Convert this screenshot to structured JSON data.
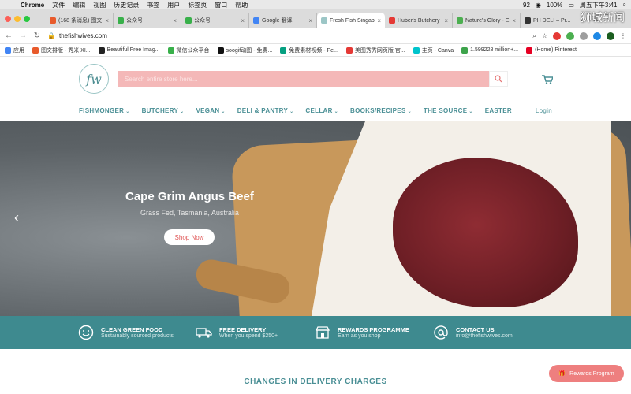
{
  "os_menubar": {
    "apple": "",
    "app": "Chrome",
    "menus": [
      "文件",
      "编辑",
      "视图",
      "历史记录",
      "书签",
      "用户",
      "标签页",
      "窗口",
      "帮助"
    ],
    "battery": "100%",
    "clock": "周五下午3:41",
    "badge": "92"
  },
  "tabs": [
    {
      "title": "(168 条消息) 图文",
      "fav_color": "#e85a2b"
    },
    {
      "title": "公众号",
      "fav_color": "#38b04a"
    },
    {
      "title": "公众号",
      "fav_color": "#38b04a"
    },
    {
      "title": "Google 翻译",
      "fav_color": "#4285f4"
    },
    {
      "title": "Fresh Fish Singap",
      "fav_color": "#9cc6c6",
      "active": true
    },
    {
      "title": "Huber's Butchery",
      "fav_color": "#e53935"
    },
    {
      "title": "Nature's Glory - E",
      "fav_color": "#4caf50"
    },
    {
      "title": "PH DELI – Pr...",
      "fav_color": "#333333"
    }
  ],
  "address": {
    "url": "thefishwives.com"
  },
  "bookmarks": [
    {
      "label": "应用",
      "color": "#4285f4"
    },
    {
      "label": "图文排版 - 秀米 XI...",
      "color": "#e85a2b"
    },
    {
      "label": "Beautiful Free Imag...",
      "color": "#222222"
    },
    {
      "label": "微信公众平台",
      "color": "#38b04a"
    },
    {
      "label": "soogif动图 - 免费...",
      "color": "#111111"
    },
    {
      "label": "免费素材视频 - Pe...",
      "color": "#05a081"
    },
    {
      "label": "美图秀秀网页版 官...",
      "color": "#e53935"
    },
    {
      "label": "主页 - Canva",
      "color": "#00c4cc"
    },
    {
      "label": "1.599228 million+...",
      "color": "#3da34b"
    },
    {
      "label": "(Home) Pinterest",
      "color": "#e60023"
    }
  ],
  "site": {
    "logo": "fw",
    "search_placeholder": "Search entire store here...",
    "nav": [
      "FISHMONGER",
      "BUTCHERY",
      "VEGAN",
      "DELI & PANTRY",
      "CELLAR",
      "BOOKS/RECIPES",
      "THE SOURCE",
      "EASTER"
    ],
    "login": "Login"
  },
  "hero": {
    "title": "Cape Grim Angus Beef",
    "subtitle": "Grass Fed, Tasmania, Australia",
    "cta": "Shop Now"
  },
  "features": [
    {
      "title": "CLEAN GREEN FOOD",
      "sub": "Sustainably sourced products",
      "icon": "smile-icon"
    },
    {
      "title": "FREE DELIVERY",
      "sub": "When you spend $250+",
      "icon": "truck-icon"
    },
    {
      "title": "REWARDS PROGRAMME",
      "sub": "Earn as you shop",
      "icon": "shop-icon"
    },
    {
      "title": "CONTACT US",
      "sub": "info@thefishwives.com",
      "icon": "at-icon"
    }
  ],
  "changes_heading": "CHANGES IN DELIVERY CHARGES",
  "rewards_button": "Rewards Program",
  "watermark": "狮城新闻",
  "colors": {
    "teal": "#3e8a8f",
    "search_pink": "#f4b8b8",
    "coral": "#ee7f7f"
  }
}
